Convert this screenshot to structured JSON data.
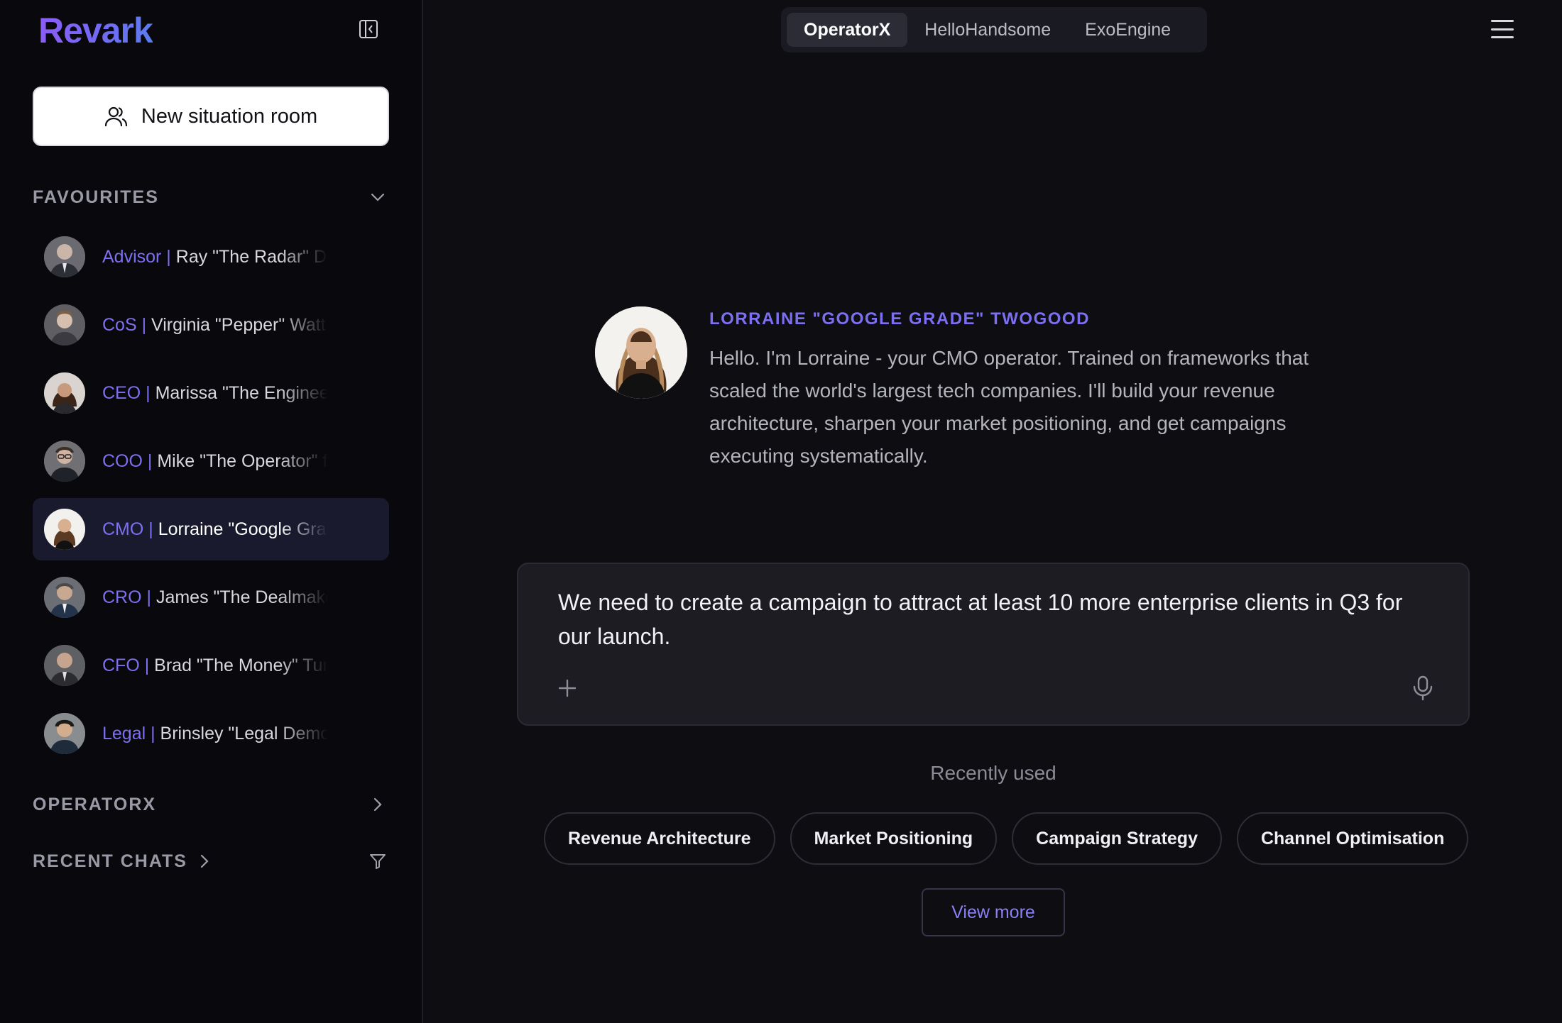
{
  "brand": {
    "logo_text": "Revark"
  },
  "sidebar": {
    "new_room_label": "New situation room",
    "favourites_title": "FAVOURITES",
    "favourites": [
      {
        "role": "Advisor |",
        "name": " Ray \"The Radar\" D",
        "active": false
      },
      {
        "role": "CoS |",
        "name": " Virginia \"Pepper\" Watt",
        "active": false
      },
      {
        "role": "CEO |",
        "name": " Marissa \"The Engineer",
        "active": false
      },
      {
        "role": "COO |",
        "name": " Mike \"The Operator\" f",
        "active": false
      },
      {
        "role": "CMO |",
        "name": " Lorraine \"Google Grad",
        "active": true
      },
      {
        "role": "CRO |",
        "name": " James \"The Dealmake",
        "active": false
      },
      {
        "role": "CFO |",
        "name": " Brad \"The Money\" Tur",
        "active": false
      },
      {
        "role": "Legal |",
        "name": " Brinsley \"Legal Demo",
        "active": false
      }
    ],
    "operatorx_title": "OPERATORX",
    "recent_chats_title": "RECENT CHATS"
  },
  "topbar": {
    "tabs": [
      {
        "label": "OperatorX",
        "active": true
      },
      {
        "label": "HelloHandsome",
        "active": false
      },
      {
        "label": "ExoEngine",
        "active": false
      }
    ]
  },
  "agent": {
    "name": "LORRAINE \"GOOGLE GRADE\" TWOGOOD",
    "intro": "Hello. I'm Lorraine - your CMO operator. Trained on frameworks that scaled the world's largest tech companies. I'll build your revenue architecture, sharpen your market positioning, and get campaigns executing systematically."
  },
  "composer": {
    "value": "We need to create a campaign to attract at least 10 more enterprise clients in Q3 for our launch."
  },
  "recent": {
    "label": "Recently used",
    "chips": [
      "Revenue Architecture",
      "Market Positioning",
      "Campaign Strategy",
      "Channel Optimisation"
    ],
    "view_more": "View more"
  },
  "colors": {
    "accent": "#7c6ff0",
    "background": "#0d0d12",
    "sidebar_bg": "#09090d",
    "active_item_bg": "#1a1a2e"
  }
}
